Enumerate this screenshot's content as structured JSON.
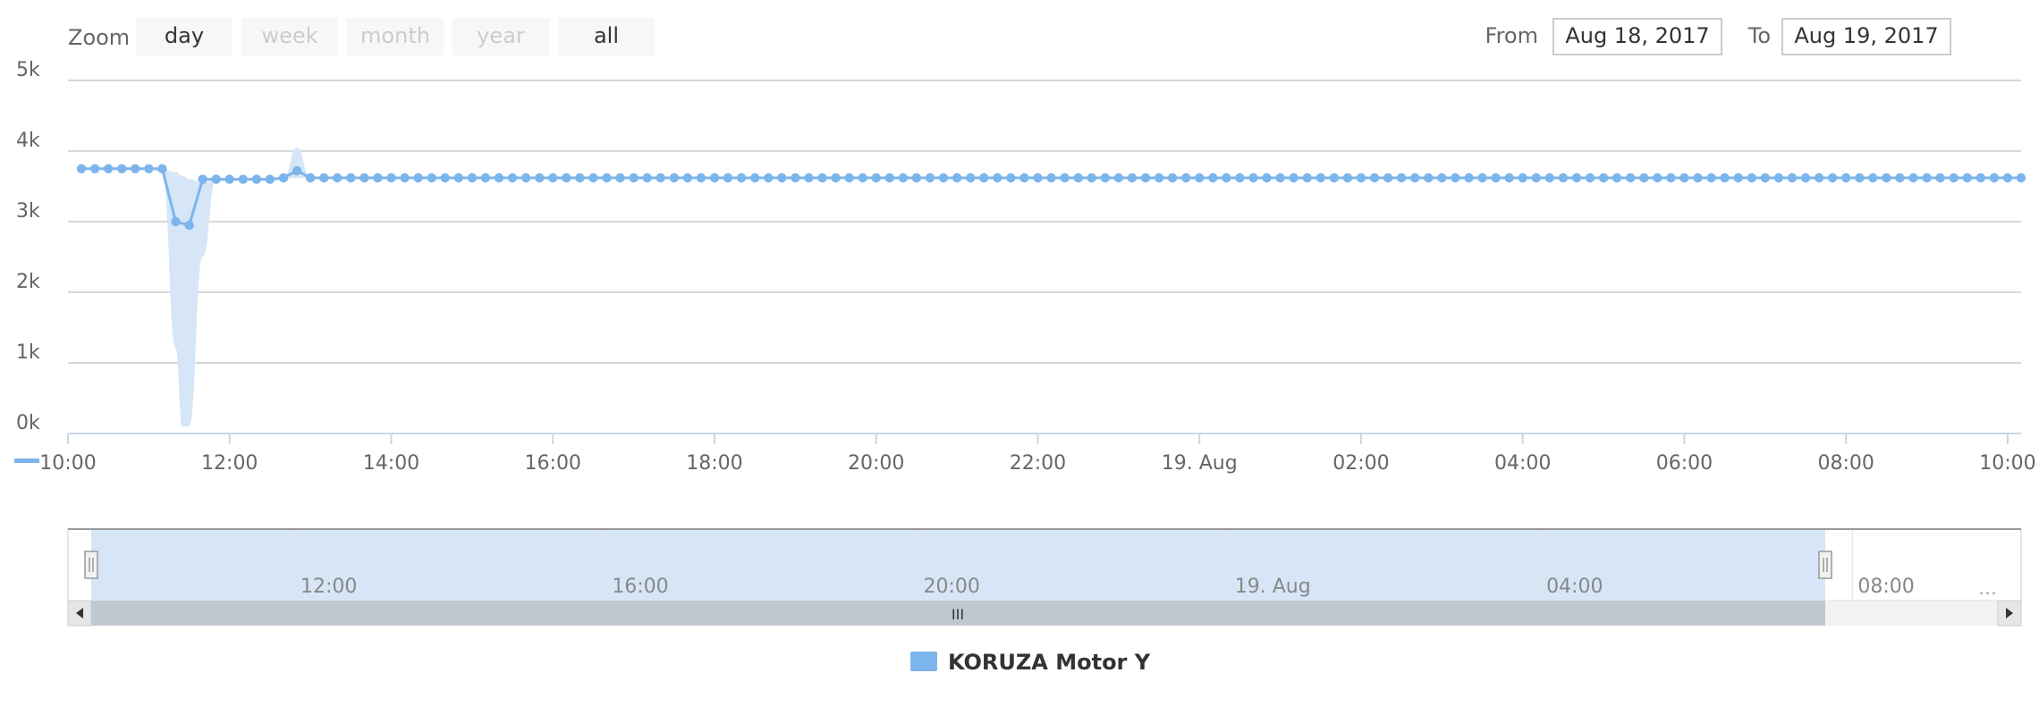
{
  "range_selector": {
    "zoom_label": "Zoom",
    "buttons": [
      {
        "label": "day",
        "enabled": true
      },
      {
        "label": "week",
        "enabled": false
      },
      {
        "label": "month",
        "enabled": false
      },
      {
        "label": "year",
        "enabled": false
      },
      {
        "label": "all",
        "enabled": true
      }
    ],
    "from_label": "From",
    "from_value": "Aug 18, 2017",
    "to_label": "To",
    "to_value": "Aug 19, 2017"
  },
  "colors": {
    "series": "#7cb5ec",
    "range_band": "#d6e6f7",
    "grid": "#cccccc",
    "axis": "#ccd6eb",
    "label": "#333333",
    "muted": "#666666",
    "disabled": "#cccccc",
    "button_bg": "#f7f7f7",
    "scrollbar_bg": "#f2f2f2",
    "scrollbar_thumb": "#bfc7d0"
  },
  "chart_data": {
    "type": "line",
    "ylim": [
      0,
      5000
    ],
    "xlim": [
      "2017-08-18 10:00",
      "2017-08-19 10:10"
    ],
    "y_ticks": [
      "0k",
      "1k",
      "2k",
      "3k",
      "4k",
      "5k"
    ],
    "x_ticks": [
      "10:00",
      "12:00",
      "14:00",
      "16:00",
      "18:00",
      "20:00",
      "22:00",
      "19. Aug",
      "02:00",
      "04:00",
      "06:00",
      "08:00",
      "10:00"
    ],
    "series": [
      {
        "name": "KORUZA Motor Y",
        "points": [
          {
            "x": "2017-08-18 10:10",
            "y": 3750
          },
          {
            "x": "2017-08-18 10:20",
            "y": 3750
          },
          {
            "x": "2017-08-18 10:30",
            "y": 3750
          },
          {
            "x": "2017-08-18 10:40",
            "y": 3750
          },
          {
            "x": "2017-08-18 10:50",
            "y": 3750
          },
          {
            "x": "2017-08-18 11:00",
            "y": 3750
          },
          {
            "x": "2017-08-18 11:10",
            "y": 3750
          },
          {
            "x": "2017-08-18 11:20",
            "y": 3000
          },
          {
            "x": "2017-08-18 11:30",
            "y": 2950
          },
          {
            "x": "2017-08-18 11:40",
            "y": 3600
          },
          {
            "x": "2017-08-18 11:50",
            "y": 3600
          },
          {
            "x": "2017-08-18 12:00",
            "y": 3600
          },
          {
            "x": "2017-08-18 12:10",
            "y": 3600
          },
          {
            "x": "2017-08-18 12:20",
            "y": 3600
          },
          {
            "x": "2017-08-18 12:30",
            "y": 3600
          },
          {
            "x": "2017-08-18 12:40",
            "y": 3620
          },
          {
            "x": "2017-08-18 12:50",
            "y": 3720
          },
          {
            "x": "2017-08-18 13:00",
            "y": 3620
          },
          {
            "x": "2017-08-19 10:10",
            "y": 3620
          }
        ],
        "step_minutes": 10
      }
    ],
    "range_band": [
      {
        "x": "2017-08-18 11:00",
        "low": 3750,
        "high": 3750
      },
      {
        "x": "2017-08-18 11:10",
        "low": 3700,
        "high": 3750
      },
      {
        "x": "2017-08-18 11:20",
        "low": 1200,
        "high": 3700
      },
      {
        "x": "2017-08-18 11:25",
        "low": 100,
        "high": 3650
      },
      {
        "x": "2017-08-18 11:30",
        "low": 100,
        "high": 3600
      },
      {
        "x": "2017-08-18 11:40",
        "low": 2500,
        "high": 3550
      },
      {
        "x": "2017-08-18 11:50",
        "low": 3600,
        "high": 3600
      },
      {
        "x": "2017-08-18 12:40",
        "low": 3600,
        "high": 3620
      },
      {
        "x": "2017-08-18 12:50",
        "low": 3620,
        "high": 4050
      },
      {
        "x": "2017-08-18 13:00",
        "low": 3620,
        "high": 3620
      }
    ],
    "legend": "bottom-center",
    "grid": true
  },
  "navigator": {
    "labels": [
      "12:00",
      "16:00",
      "20:00",
      "19. Aug",
      "04:00",
      "08:00"
    ],
    "ellipsis": "...",
    "selection_start": "2017-08-18 10:10",
    "selection_end": "2017-08-19 07:20",
    "scrollbar_grip": "III"
  },
  "legend": {
    "label": "KORUZA Motor Y"
  }
}
